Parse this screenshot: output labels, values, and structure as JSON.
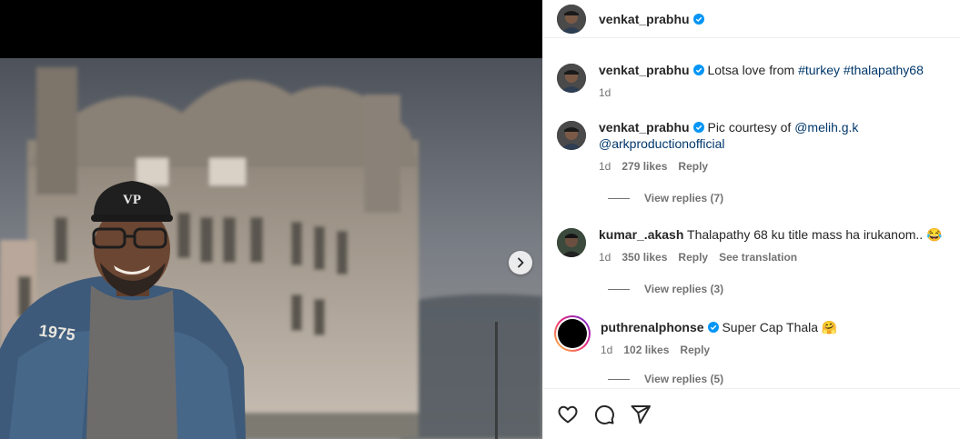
{
  "post": {
    "author": "venkat_prabhu",
    "caption_user": "venkat_prabhu",
    "caption_text": "Lotsa love from",
    "caption_tags": [
      "#turkey",
      "#thalapathy68"
    ],
    "caption_time": "1d"
  },
  "comments": [
    {
      "user": "venkat_prabhu",
      "text": "Pic courtesy of",
      "mentions": [
        "@melih.g.k",
        "@arkproductionofficial"
      ],
      "time": "1d",
      "likes": "279 likes",
      "reply": "Reply",
      "view_replies": "View replies (7)"
    },
    {
      "user": "kumar_.akash",
      "text": "Thalapathy 68 ku title mass ha irukanom.. 😂",
      "time": "1d",
      "likes": "350 likes",
      "reply": "Reply",
      "see_translation": "See translation",
      "view_replies": "View replies (3)"
    },
    {
      "user": "puthrenalphonse",
      "text": "Super Cap Thala 🤗",
      "time": "1d",
      "likes": "102 likes",
      "reply": "Reply",
      "view_replies": "View replies (5)"
    }
  ],
  "icons": {
    "verified": "verified-badge-icon",
    "next": "chevron-right-icon",
    "like": "heart-icon",
    "comment": "comment-icon",
    "share": "send-icon"
  },
  "photo_cap_text": "VP",
  "photo_jacket_text": "1975",
  "colors": {
    "verified": "#0095f6",
    "link": "#00376b",
    "muted": "#737373"
  }
}
